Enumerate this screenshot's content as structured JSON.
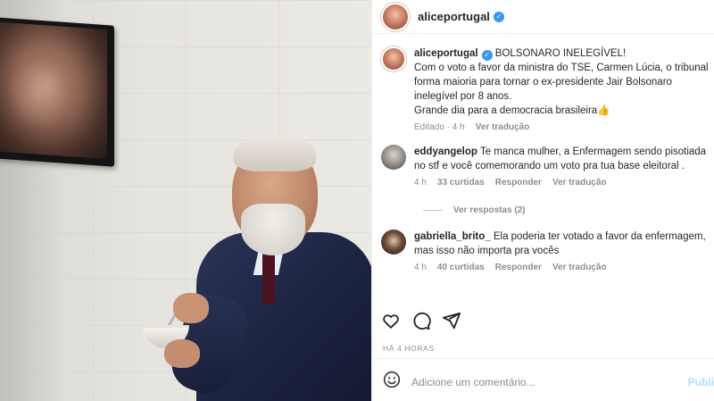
{
  "header": {
    "username": "aliceportugal"
  },
  "caption": {
    "username": "aliceportugal",
    "title": "BOLSONARO INELEGÍVEL!",
    "line1": "Com o voto a favor da ministra do TSE, Carmen Lúcia, o tribunal",
    "line2": "forma maioria para tornar o ex-presidente Jair Bolsonaro",
    "line3": "inelegível por 8 anos.",
    "line4": "Grande dia para a democracia brasileira👍",
    "edited": "Editado · 4 h",
    "translate": "Ver tradução"
  },
  "comments": [
    {
      "username": "eddyangelop",
      "line1": "Te manca mulher, a Enfermagem sendo pisotiada",
      "line2": "no stf e você comemorando um voto pra tua base eleitoral .",
      "time": "4 h",
      "likes": "33 curtidas",
      "reply": "Responder",
      "translate": "Ver tradução"
    },
    {
      "username": "gabriella_brito_",
      "line1": "Ela poderia ter votado a favor da enfermagem,",
      "line2": "mas isso não importa pra vocês",
      "time": "4 h",
      "likes": "40 curtidas",
      "reply": "Responder",
      "translate": "Ver tradução"
    }
  ],
  "view_replies": "Ver respostas (2)",
  "timestamp": "HÁ 4 HORAS",
  "add_comment": {
    "placeholder": "Adicione um comentário...",
    "publish": "Publi"
  },
  "icons": [
    "heart-icon",
    "comment-icon",
    "share-icon",
    "emoji-icon",
    "verified-icon"
  ],
  "colors": {
    "verified": "#3897f0",
    "publish": "#b3dbff",
    "meta": "#8e8e8e"
  }
}
